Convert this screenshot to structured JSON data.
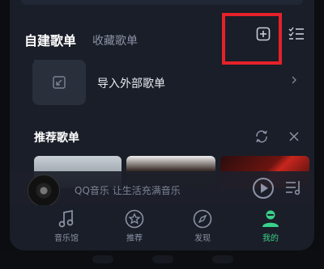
{
  "tabs": {
    "created": "自建歌单",
    "favorites": "收藏歌单"
  },
  "import": {
    "label": "导入外部歌单"
  },
  "recommend": {
    "title": "推荐歌单"
  },
  "player": {
    "text": "QQ音乐 让生活充满音乐"
  },
  "bottom_nav": {
    "items": [
      {
        "label": "音乐馆",
        "icon": "music-note-icon"
      },
      {
        "label": "推荐",
        "icon": "star-icon"
      },
      {
        "label": "发现",
        "icon": "compass-icon"
      },
      {
        "label": "我的",
        "icon": "person-icon"
      }
    ],
    "active_index": 3
  },
  "colors": {
    "accent": "#39d18a",
    "highlight": "#e5212a",
    "background": "#1a1e28"
  }
}
